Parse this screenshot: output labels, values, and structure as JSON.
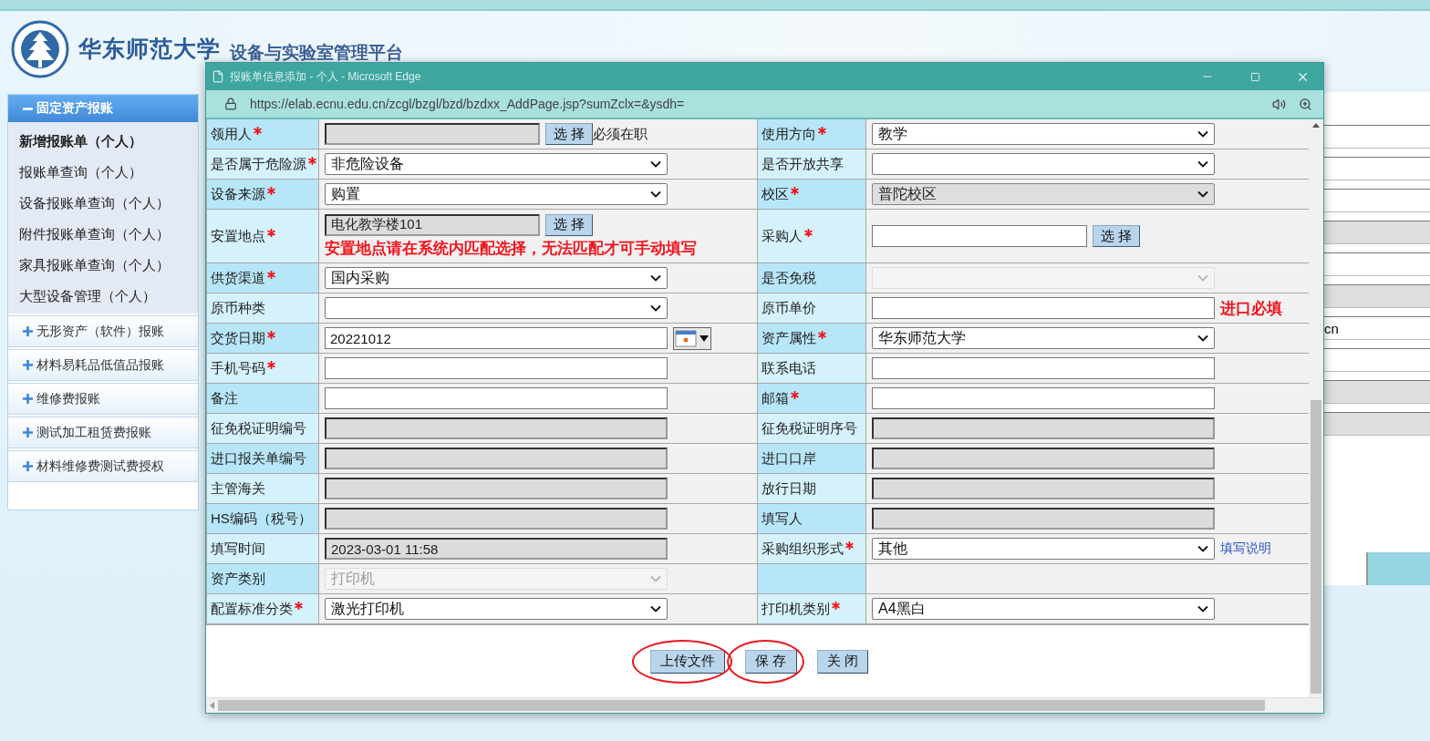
{
  "header": {
    "title": "华东师范大学",
    "subtitle": "设备与实验室管理平台"
  },
  "sidebar": [
    {
      "title": "固定资产报账",
      "expanded": true,
      "items": [
        {
          "label": "新增报账单（个人）",
          "selected": true
        },
        {
          "label": "报账单查询（个人）",
          "selected": false
        },
        {
          "label": "设备报账单查询（个人）",
          "selected": false
        },
        {
          "label": "附件报账单查询（个人）",
          "selected": false
        },
        {
          "label": "家具报账单查询（个人）",
          "selected": false
        },
        {
          "label": "大型设备管理（个人）",
          "selected": false
        }
      ]
    },
    {
      "title": "无形资产（软件）报账",
      "expanded": false
    },
    {
      "title": "材料易耗品低值品报账",
      "expanded": false
    },
    {
      "title": "维修费报账",
      "expanded": false
    },
    {
      "title": "测试加工租赁费报账",
      "expanded": false
    },
    {
      "title": "材料维修费测试费授权",
      "expanded": false
    }
  ],
  "background": {
    "field_text": "cn"
  },
  "popup": {
    "title": "报账单信息添加 - 个人 - Microsoft Edge",
    "url": "https://elab.ecnu.edu.cn/zcgl/bzgl/bzd/bzdxx_AddPage.jsp?sumZclx=&ysdh="
  },
  "form": {
    "rows": [
      {
        "left": {
          "label": "领用人",
          "required": true,
          "control": {
            "kind": "picker",
            "readonly": true,
            "disabled": false,
            "button": "选 择",
            "note": {
              "text": "必须在职",
              "kind": "plain"
            }
          }
        },
        "right": {
          "label": "使用方向",
          "required": true,
          "control": {
            "kind": "select",
            "readonly": false,
            "disabled": false,
            "value": "教学"
          }
        }
      },
      {
        "left": {
          "label": "是否属于危险源",
          "required": true,
          "control": {
            "kind": "select",
            "readonly": false,
            "disabled": false,
            "value": "非危险设备"
          }
        },
        "right": {
          "label": "是否开放共享",
          "required": false,
          "control": {
            "kind": "select",
            "readonly": false,
            "disabled": false
          }
        }
      },
      {
        "left": {
          "label": "设备来源",
          "required": true,
          "control": {
            "kind": "select",
            "readonly": false,
            "disabled": false,
            "value": "购置"
          }
        },
        "right": {
          "label": "校区",
          "required": true,
          "control": {
            "kind": "select",
            "readonly": true,
            "disabled": false,
            "value": "普陀校区"
          }
        }
      },
      {
        "left": {
          "label": "安置地点",
          "required": true,
          "control": {
            "kind": "picker",
            "readonly": true,
            "disabled": false,
            "value": "电化教学楼101",
            "button": "选 择",
            "note": {
              "text": "安置地点请在系统内匹配选择，无法匹配才可手动填写",
              "kind": "alert_block"
            }
          }
        },
        "right": {
          "label": "采购人",
          "required": true,
          "control": {
            "kind": "picker",
            "readonly": false,
            "disabled": false,
            "button": "选 择"
          }
        }
      },
      {
        "left": {
          "label": "供货渠道",
          "required": true,
          "control": {
            "kind": "select",
            "readonly": false,
            "disabled": false,
            "value": "国内采购"
          }
        },
        "right": {
          "label": "是否免税",
          "required": false,
          "control": {
            "kind": "select",
            "readonly": false,
            "disabled": true
          }
        }
      },
      {
        "left": {
          "label": "原币种类",
          "required": false,
          "control": {
            "kind": "select",
            "readonly": false,
            "disabled": false
          }
        },
        "right": {
          "label": "原币单价",
          "required": false,
          "control": {
            "kind": "text",
            "readonly": false,
            "disabled": false,
            "note": {
              "text": "进口必填",
              "kind": "alert"
            }
          }
        }
      },
      {
        "left": {
          "label": "交货日期",
          "required": true,
          "control": {
            "kind": "date",
            "readonly": false,
            "disabled": false,
            "value": "20221012"
          }
        },
        "right": {
          "label": "资产属性",
          "required": true,
          "control": {
            "kind": "select",
            "readonly": false,
            "disabled": false,
            "value": "华东师范大学"
          }
        }
      },
      {
        "left": {
          "label": "手机号码",
          "required": true,
          "control": {
            "kind": "text",
            "readonly": false,
            "disabled": false
          }
        },
        "right": {
          "label": "联系电话",
          "required": false,
          "control": {
            "kind": "text",
            "readonly": false,
            "disabled": false
          }
        }
      },
      {
        "left": {
          "label": "备注",
          "required": false,
          "control": {
            "kind": "text",
            "readonly": false,
            "disabled": false
          }
        },
        "right": {
          "label": "邮箱",
          "required": true,
          "control": {
            "kind": "text",
            "readonly": false,
            "disabled": false
          }
        }
      },
      {
        "left": {
          "label": "征免税证明编号",
          "required": false,
          "control": {
            "kind": "text",
            "readonly": true,
            "disabled": false
          }
        },
        "right": {
          "label": "征免税证明序号",
          "required": false,
          "control": {
            "kind": "text",
            "readonly": true,
            "disabled": false
          }
        }
      },
      {
        "left": {
          "label": "进口报关单编号",
          "required": false,
          "control": {
            "kind": "text",
            "readonly": true,
            "disabled": false
          }
        },
        "right": {
          "label": "进口口岸",
          "required": false,
          "control": {
            "kind": "text",
            "readonly": true,
            "disabled": false
          }
        }
      },
      {
        "left": {
          "label": "主管海关",
          "required": false,
          "control": {
            "kind": "text",
            "readonly": true,
            "disabled": false
          }
        },
        "right": {
          "label": "放行日期",
          "required": false,
          "control": {
            "kind": "text",
            "readonly": true,
            "disabled": false
          }
        }
      },
      {
        "left": {
          "label": "HS编码（税号）",
          "required": false,
          "control": {
            "kind": "text",
            "readonly": true,
            "disabled": false
          }
        },
        "right": {
          "label": "填写人",
          "required": false,
          "control": {
            "kind": "text",
            "readonly": true,
            "disabled": false
          }
        }
      },
      {
        "left": {
          "label": "填写时间",
          "required": false,
          "control": {
            "kind": "text",
            "readonly": true,
            "disabled": false,
            "value": "2023-03-01 11:58"
          }
        },
        "right": {
          "label": "采购组织形式",
          "required": true,
          "control": {
            "kind": "select",
            "readonly": false,
            "disabled": false,
            "value": "其他",
            "note": {
              "text": "填写说明",
              "kind": "link"
            }
          }
        }
      },
      {
        "left": {
          "label": "资产类别",
          "required": false,
          "control": {
            "kind": "select",
            "readonly": false,
            "disabled": true,
            "value": "打印机"
          }
        }
      },
      {
        "left": {
          "label": "配置标准分类",
          "required": true,
          "control": {
            "kind": "select",
            "readonly": false,
            "disabled": false,
            "value": "激光打印机"
          }
        },
        "right": {
          "label": "打印机类别",
          "required": true,
          "control": {
            "kind": "select",
            "readonly": false,
            "disabled": false,
            "value": "A4黑白"
          }
        }
      }
    ]
  },
  "buttons": [
    {
      "label": "上传文件",
      "circled": true
    },
    {
      "label": "保 存",
      "circled": true
    },
    {
      "label": "关 闭",
      "circled": false
    }
  ]
}
